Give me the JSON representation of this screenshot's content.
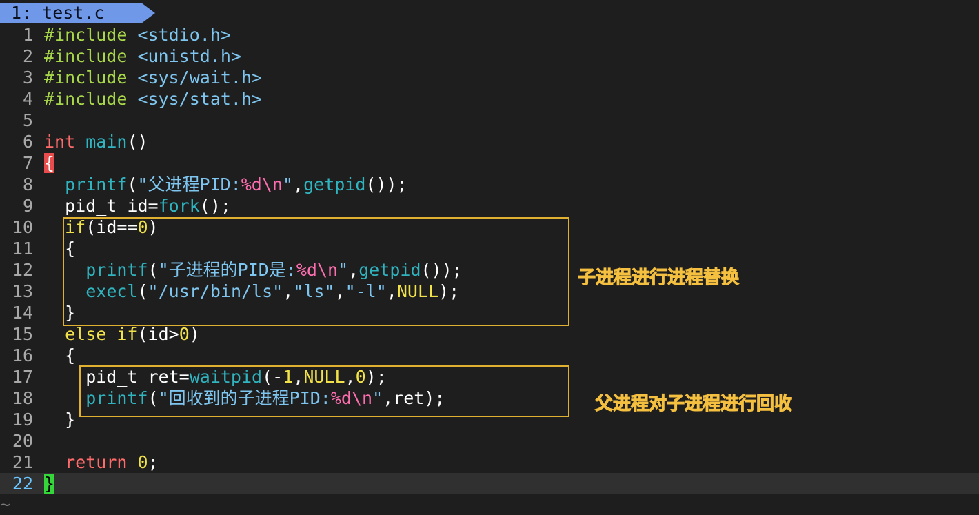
{
  "tab": {
    "label": "1: test.c"
  },
  "lines": [
    {
      "no": "1",
      "tokens": [
        [
          "pre",
          "#include "
        ],
        [
          "hdr",
          "<stdio.h>"
        ]
      ]
    },
    {
      "no": "2",
      "tokens": [
        [
          "pre",
          "#include "
        ],
        [
          "hdr",
          "<unistd.h>"
        ]
      ]
    },
    {
      "no": "3",
      "tokens": [
        [
          "pre",
          "#include "
        ],
        [
          "hdr",
          "<sys/wait.h>"
        ]
      ]
    },
    {
      "no": "4",
      "tokens": [
        [
          "pre",
          "#include "
        ],
        [
          "hdr",
          "<sys/stat.h>"
        ]
      ]
    },
    {
      "no": "5",
      "tokens": []
    },
    {
      "no": "6",
      "tokens": [
        [
          "kw",
          "int"
        ],
        [
          "pl",
          " "
        ],
        [
          "fn",
          "main"
        ],
        [
          "pl",
          "()"
        ]
      ]
    },
    {
      "no": "7",
      "tokens": [
        [
          "brace-red",
          "{"
        ]
      ]
    },
    {
      "no": "8",
      "tokens": [
        [
          "pl",
          "  "
        ],
        [
          "fn",
          "printf"
        ],
        [
          "pl",
          "("
        ],
        [
          "str",
          "\"父进程PID:"
        ],
        [
          "esc",
          "%d\\n"
        ],
        [
          "str",
          "\""
        ],
        [
          "pl",
          ","
        ],
        [
          "fn",
          "getpid"
        ],
        [
          "pl",
          "());"
        ]
      ]
    },
    {
      "no": "9",
      "tokens": [
        [
          "pl",
          "  pid_t id="
        ],
        [
          "fn",
          "fork"
        ],
        [
          "pl",
          "();"
        ]
      ]
    },
    {
      "no": "10",
      "tokens": [
        [
          "pl",
          "  "
        ],
        [
          "ctl",
          "if"
        ],
        [
          "pl",
          "(id=="
        ],
        [
          "num",
          "0"
        ],
        [
          "pl",
          ")"
        ]
      ]
    },
    {
      "no": "11",
      "tokens": [
        [
          "pl",
          "  {"
        ]
      ]
    },
    {
      "no": "12",
      "tokens": [
        [
          "pl",
          "    "
        ],
        [
          "fn",
          "printf"
        ],
        [
          "pl",
          "("
        ],
        [
          "str",
          "\"子进程的PID是:"
        ],
        [
          "esc",
          "%d\\n"
        ],
        [
          "str",
          "\""
        ],
        [
          "pl",
          ","
        ],
        [
          "fn",
          "getpid"
        ],
        [
          "pl",
          "());"
        ]
      ]
    },
    {
      "no": "13",
      "tokens": [
        [
          "pl",
          "    "
        ],
        [
          "fn",
          "execl"
        ],
        [
          "pl",
          "("
        ],
        [
          "str",
          "\"/usr/bin/ls\""
        ],
        [
          "pl",
          ","
        ],
        [
          "str",
          "\"ls\""
        ],
        [
          "pl",
          ","
        ],
        [
          "str",
          "\"-l\""
        ],
        [
          "pl",
          ","
        ],
        [
          "num",
          "NULL"
        ],
        [
          "pl",
          ");"
        ]
      ]
    },
    {
      "no": "14",
      "tokens": [
        [
          "pl",
          "  }"
        ]
      ]
    },
    {
      "no": "15",
      "tokens": [
        [
          "pl",
          "  "
        ],
        [
          "ctl",
          "else if"
        ],
        [
          "pl",
          "(id>"
        ],
        [
          "num",
          "0"
        ],
        [
          "pl",
          ")"
        ]
      ]
    },
    {
      "no": "16",
      "tokens": [
        [
          "pl",
          "  {"
        ]
      ]
    },
    {
      "no": "17",
      "tokens": [
        [
          "pl",
          "    pid_t ret="
        ],
        [
          "fn",
          "waitpid"
        ],
        [
          "pl",
          "(-"
        ],
        [
          "num",
          "1"
        ],
        [
          "pl",
          ","
        ],
        [
          "num",
          "NULL"
        ],
        [
          "pl",
          ","
        ],
        [
          "num",
          "0"
        ],
        [
          "pl",
          ");"
        ]
      ]
    },
    {
      "no": "18",
      "tokens": [
        [
          "pl",
          "    "
        ],
        [
          "fn",
          "printf"
        ],
        [
          "pl",
          "("
        ],
        [
          "str",
          "\"回收到的子进程PID:"
        ],
        [
          "esc",
          "%d\\n"
        ],
        [
          "str",
          "\""
        ],
        [
          "pl",
          ",ret);"
        ]
      ]
    },
    {
      "no": "19",
      "tokens": [
        [
          "pl",
          "  }"
        ]
      ]
    },
    {
      "no": "20",
      "tokens": []
    },
    {
      "no": "21",
      "tokens": [
        [
          "pl",
          "  "
        ],
        [
          "kw",
          "return"
        ],
        [
          "pl",
          " "
        ],
        [
          "num",
          "0"
        ],
        [
          "pl",
          ";"
        ]
      ]
    },
    {
      "no": "22",
      "tokens": [
        [
          "brace-green",
          "}"
        ]
      ],
      "current": true
    }
  ],
  "annotations": {
    "child": "子进程进行进程替换",
    "parent": "父进程对子进程进行回收"
  },
  "empty_marker": "~",
  "colors": {
    "tab_bg": "#6f99e8",
    "box_border": "#e0b030",
    "annotation_text": "#f0b020"
  }
}
